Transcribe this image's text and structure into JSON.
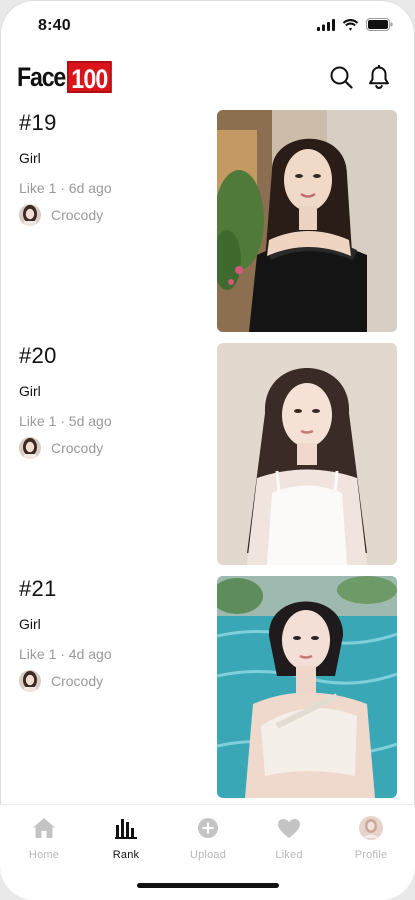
{
  "status_bar": {
    "time": "8:40"
  },
  "header": {
    "logo_text": "Face",
    "logo_number": "100"
  },
  "feed": [
    {
      "rank": "#19",
      "category": "Girl",
      "meta": "Like 1 · 6d ago",
      "user": "Crocody"
    },
    {
      "rank": "#20",
      "category": "Girl",
      "meta": "Like 1 · 5d ago",
      "user": "Crocody"
    },
    {
      "rank": "#21",
      "category": "Girl",
      "meta": "Like 1 · 4d ago",
      "user": "Crocody"
    }
  ],
  "tabs": [
    {
      "label": "Home",
      "icon": "home-icon",
      "active": false
    },
    {
      "label": "Rank",
      "icon": "rank-icon",
      "active": true
    },
    {
      "label": "Upload",
      "icon": "upload-icon",
      "active": false
    },
    {
      "label": "Liked",
      "icon": "heart-icon",
      "active": false
    },
    {
      "label": "Profile",
      "icon": "avatar",
      "active": false
    }
  ],
  "colors": {
    "brand_red": "#d9141b",
    "inactive_tab": "#b8b8b8",
    "muted_text": "#999999"
  }
}
